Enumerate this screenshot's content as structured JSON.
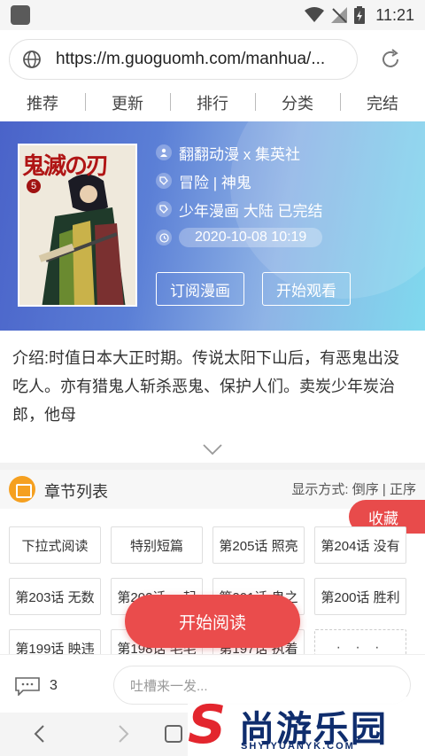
{
  "status_bar": {
    "time": "11:21"
  },
  "browser": {
    "url": "https://m.guoguomh.com/manhua/..."
  },
  "nav_tabs": [
    "推荐",
    "更新",
    "排行",
    "分类",
    "完结"
  ],
  "comic": {
    "cover_title": "鬼滅の刃",
    "cover_volume": "5",
    "publisher": "翻翻动漫 x 集英社",
    "genres": "冒险 | 神鬼",
    "category": "少年漫画 大陆 已完结",
    "updated_at": "2020-10-08 10:19",
    "subscribe_label": "订阅漫画",
    "start_watch_label": "开始观看",
    "intro": "介绍:时值日本大正时期。传说太阳下山后，有恶鬼出没吃人。亦有猎鬼人斩杀恶鬼、保护人们。卖炭少年炭治郎，他母"
  },
  "chapters": {
    "title": "章节列表",
    "sort_label": "显示方式: 倒序 | 正序",
    "favorite_label": "收藏",
    "items": [
      "下拉式阅读",
      "特别短篇",
      "第205话 照亮",
      "第204话 没有",
      "第203话 无数",
      "第202话 一起",
      "第201话 鬼之",
      "第200话 胜利",
      "第199话 眏违",
      "第198话 毛毛",
      "第197话 执着"
    ],
    "more_label": "· · ·",
    "start_read_label": "开始阅读"
  },
  "comments": {
    "count": "3",
    "placeholder": "吐槽来一发..."
  },
  "watermark": {
    "cn": "尚游乐园",
    "en": "SHYIYUANYK.COM"
  },
  "colors": {
    "accent": "#ea4c4c",
    "brand_navy": "#0f2d6d",
    "icon_orange": "#f5a020"
  }
}
